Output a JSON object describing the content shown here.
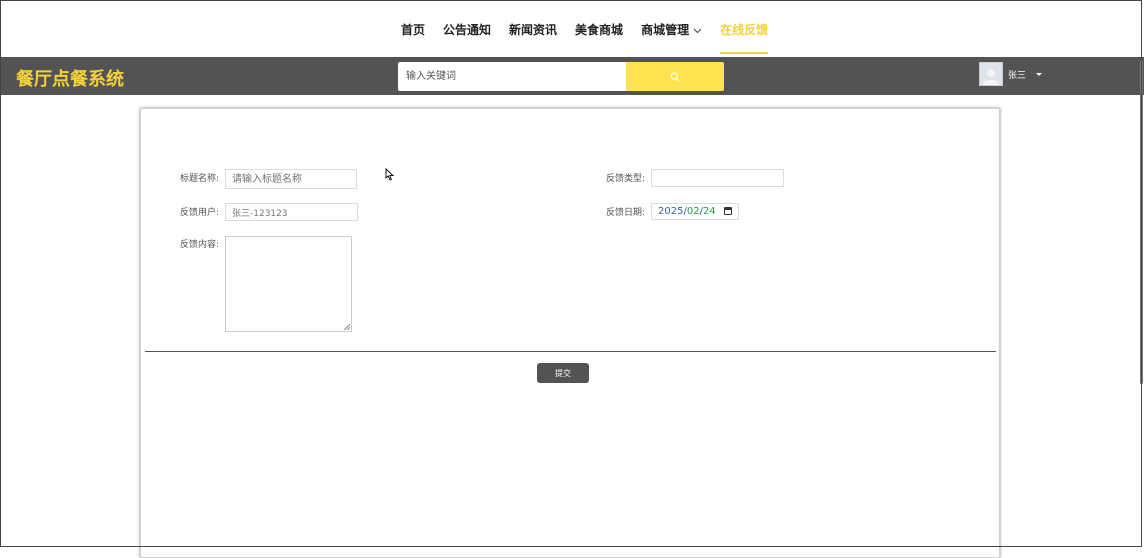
{
  "topnav": {
    "items": [
      {
        "label": "首页",
        "active": false
      },
      {
        "label": "公告通知",
        "active": false
      },
      {
        "label": "新闻资讯",
        "active": false
      },
      {
        "label": "美食商城",
        "active": false
      },
      {
        "label": "商城管理",
        "active": false,
        "has_dropdown": true
      },
      {
        "label": "在线反馈",
        "active": true
      }
    ]
  },
  "header": {
    "logo": "餐厅点餐系统",
    "search": {
      "placeholder": "输入关键词",
      "icon": "search-icon"
    },
    "user": {
      "name": "张三",
      "avatar_icon": "user-avatar-icon"
    }
  },
  "form": {
    "title_label": "标题名称:",
    "title_placeholder": "请输入标题名称",
    "type_label": "反馈类型:",
    "type_value": "",
    "user_label": "反馈用户:",
    "user_value": "张三-123123",
    "date_label": "反馈日期:",
    "date_year": "2025",
    "date_month": "02",
    "date_day": "24",
    "content_label": "反馈内容:",
    "content_value": "",
    "submit_label": "提交"
  },
  "colors": {
    "accent": "#f3d23a",
    "header_bg": "#535353",
    "search_button": "#ffe34f"
  }
}
